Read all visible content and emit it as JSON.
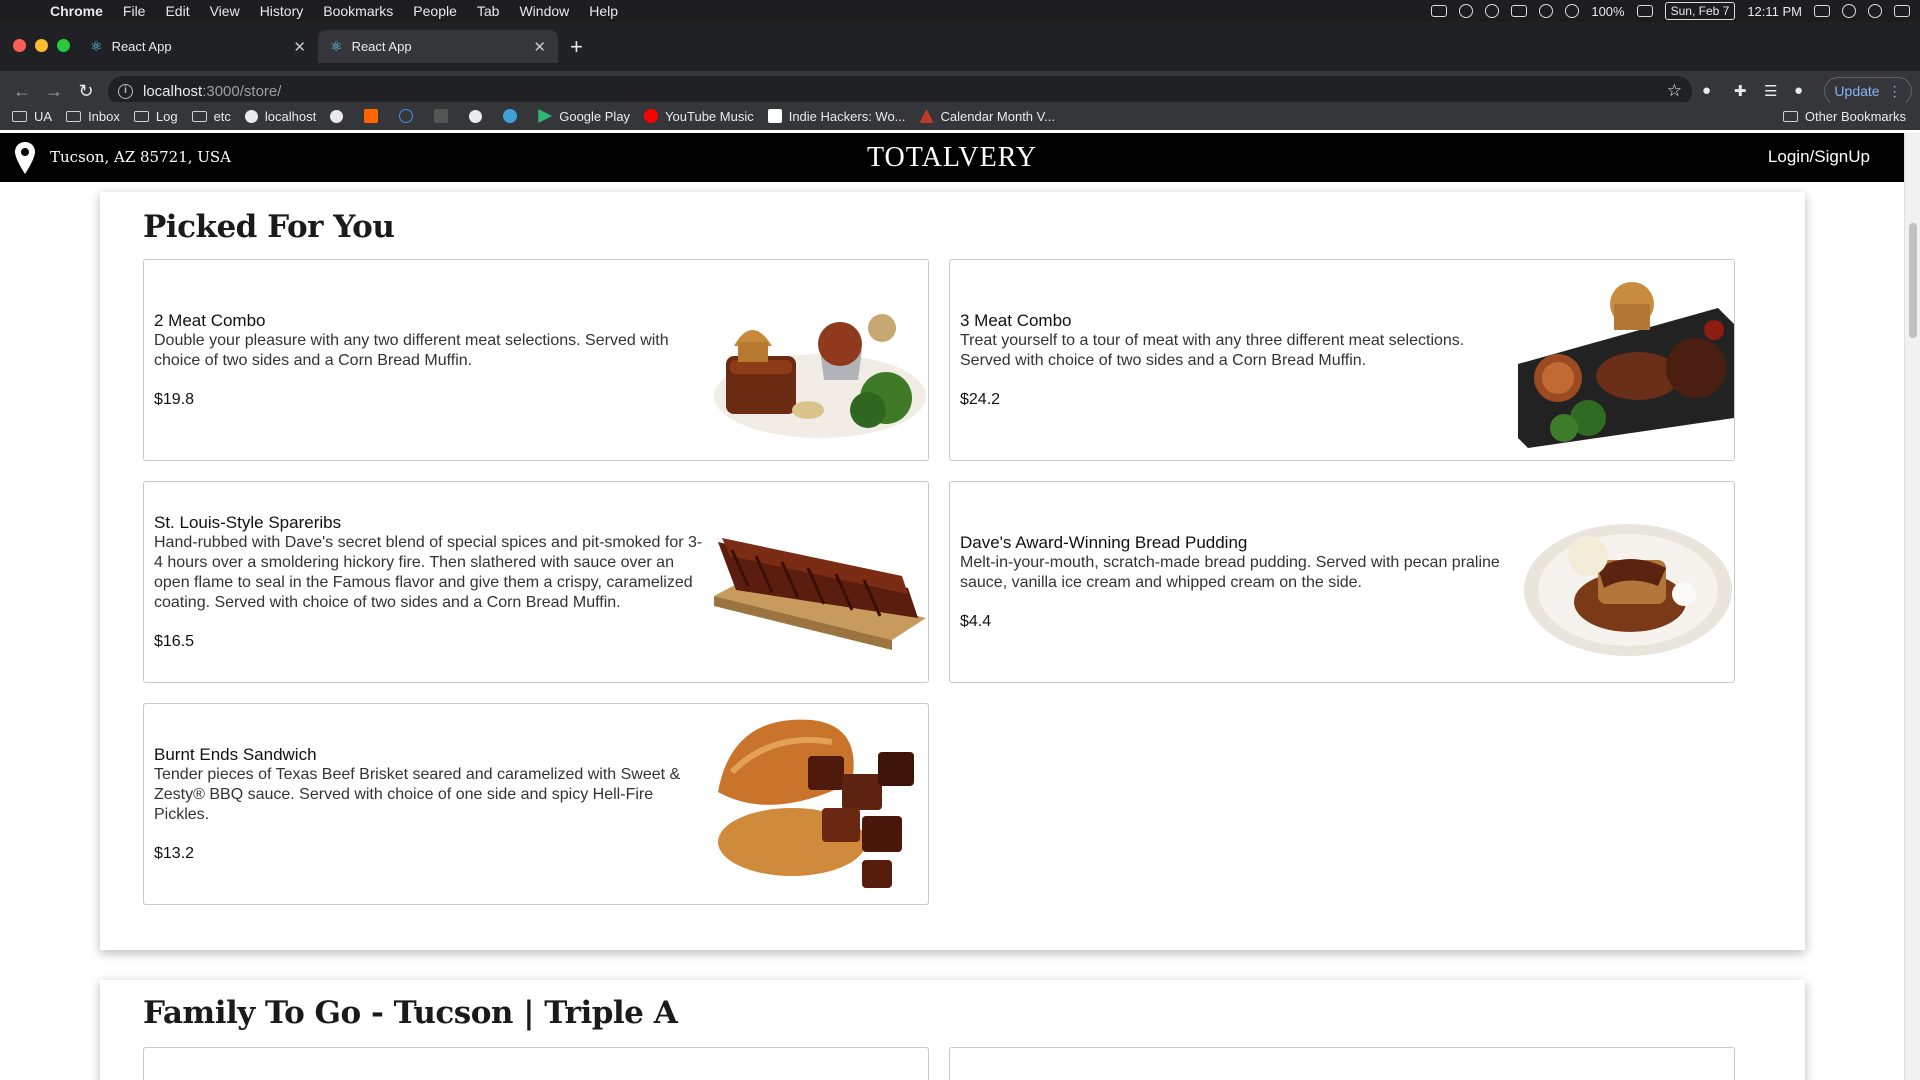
{
  "menubar": {
    "app_name": "Chrome",
    "items": [
      "File",
      "Edit",
      "View",
      "History",
      "Bookmarks",
      "People",
      "Tab",
      "Window",
      "Help"
    ],
    "battery": "100%",
    "date": "Sun, Feb 7",
    "time": "12:11 PM"
  },
  "tabs": [
    {
      "title": "React App"
    },
    {
      "title": "React App"
    }
  ],
  "toolbar": {
    "url_host": "localhost",
    "url_path": ":3000/store/",
    "update_label": "Update"
  },
  "bookmarks": [
    {
      "label": "UA",
      "icon": "folder-icon"
    },
    {
      "label": "Inbox",
      "icon": "folder-icon"
    },
    {
      "label": "Log",
      "icon": "folder-icon"
    },
    {
      "label": "etc",
      "icon": "folder-icon"
    },
    {
      "label": "localhost",
      "icon": "globe-icon"
    },
    {
      "label": "Google Play",
      "icon": "play-icon"
    },
    {
      "label": "YouTube Music",
      "icon": "youtube-music-icon"
    },
    {
      "label": "Indie Hackers: Wo...",
      "icon": "indie-hackers-icon"
    },
    {
      "label": "Calendar Month V...",
      "icon": "calendar-icon"
    }
  ],
  "other_bookmarks": "Other Bookmarks",
  "header": {
    "location": "Tucson, AZ 85721, USA",
    "brand": "TOTALVERY",
    "login": "Login/SignUp"
  },
  "sections": [
    {
      "title": "Picked For You",
      "items": [
        {
          "name": "2 Meat Combo",
          "description": "Double your pleasure with any two different meat selections. Served with choice of two sides and a Corn Bread Muffin.",
          "price": "$19.8"
        },
        {
          "name": "3 Meat Combo",
          "description": "Treat yourself to a tour of meat with any three different meat selections. Served with choice of two sides and a Corn Bread Muffin.",
          "price": "$24.2"
        },
        {
          "name": "St. Louis-Style Spareribs",
          "description": "Hand-rubbed with Dave's secret blend of special spices and pit-smoked for 3-4 hours over a smoldering hickory fire. Then slathered with sauce over an open flame to seal in the Famous flavor and give them a crispy, caramelized coating. Served with choice of two sides and a Corn Bread Muffin.",
          "price": "$16.5"
        },
        {
          "name": "Dave's Award-Winning Bread Pudding",
          "description": "Melt-in-your-mouth, scratch-made bread pudding. Served with pecan praline sauce, vanilla ice cream and whipped cream on the side.",
          "price": "$4.4"
        },
        {
          "name": "Burnt Ends Sandwich",
          "description": "Tender pieces of Texas Beef Brisket seared and caramelized with Sweet & Zesty® BBQ sauce. Served with choice of one side and spicy Hell-Fire Pickles.",
          "price": "$13.2"
        }
      ]
    },
    {
      "title": "Family To Go - Tucson | Triple A"
    }
  ]
}
